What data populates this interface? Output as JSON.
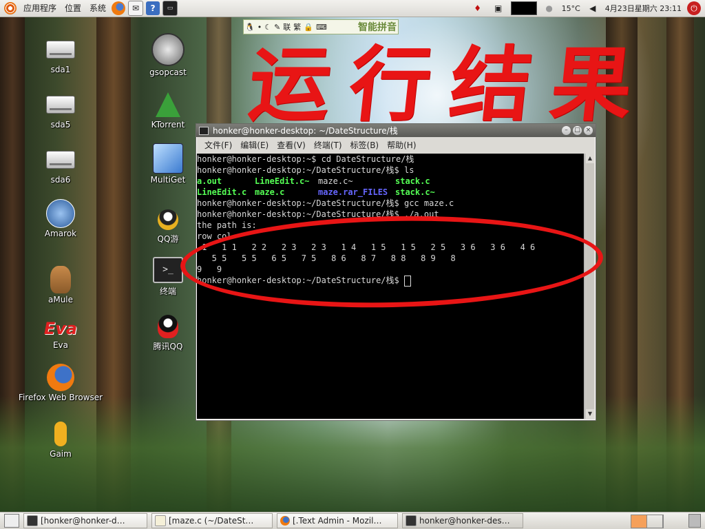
{
  "top_panel": {
    "menus": [
      "应用程序",
      "位置",
      "系统"
    ],
    "temperature": "15°C",
    "datetime": "4月23日星期六 23:11"
  },
  "ime": {
    "symbols": [
      "联",
      "繁"
    ],
    "name": "智能拼音"
  },
  "annotation": {
    "text": "运行结果"
  },
  "desktop_icons": [
    {
      "label": "sda1",
      "icon": "drive-icon"
    },
    {
      "label": "sda5",
      "icon": "drive-icon"
    },
    {
      "label": "sda6",
      "icon": "drive-icon"
    },
    {
      "label": "Amarok",
      "icon": "amarok-icon"
    },
    {
      "label": "aMule",
      "icon": "amule-icon"
    },
    {
      "label": "Eva",
      "icon": "eva-icon"
    },
    {
      "label": "Firefox Web Browser",
      "icon": "firefox-icon"
    },
    {
      "label": "Gaim",
      "icon": "gaim-icon"
    },
    {
      "label": "gsopcast",
      "icon": "gsopcast-icon"
    },
    {
      "label": "KTorrent",
      "icon": "ktorrent-icon"
    },
    {
      "label": "MultiGet",
      "icon": "multiget-icon"
    },
    {
      "label": "QQ游",
      "icon": "qq-game-icon"
    },
    {
      "label": "终端",
      "icon": "terminal-icon"
    },
    {
      "label": "腾讯QQ",
      "icon": "qq-icon"
    }
  ],
  "terminal": {
    "title": "honker@honker-desktop: ~/DateStructure/栈",
    "menu": [
      "文件(F)",
      "编辑(E)",
      "查看(V)",
      "终端(T)",
      "标签(B)",
      "帮助(H)"
    ],
    "lines": [
      "honker@honker-desktop:~$ cd DateStructure/栈",
      "honker@honker-desktop:~/DateStructure/栈$ ls",
      "",
      "",
      "honker@honker-desktop:~/DateStructure/栈$ gcc maze.c",
      "honker@honker-desktop:~/DateStructure/栈$ ./a.out",
      "the path is:",
      "row col",
      " 1   1 1   2 2   2 3   2 3   1 4   1 5   1 5   2 5   3 6   3 6   4 6",
      "   5 5   5 5   6 5   7 5   8 6   8 7   8 8   8 9   8",
      "9   9",
      "honker@honker-desktop:~/DateStructure/栈$ "
    ],
    "ls_files": [
      {
        "name": "a.out",
        "kind": "exec"
      },
      {
        "name": "LineEdit.c~",
        "kind": "exec"
      },
      {
        "name": "maze.c~",
        "kind": "plain"
      },
      {
        "name": "stack.c",
        "kind": "exec"
      },
      {
        "name": "LineEdit.c",
        "kind": "exec"
      },
      {
        "name": "maze.c",
        "kind": "exec"
      },
      {
        "name": "maze.rar_FILES",
        "kind": "dir"
      },
      {
        "name": "stack.c~",
        "kind": "exec"
      }
    ]
  },
  "taskbar": {
    "tasks": [
      {
        "label": "[honker@honker-d…",
        "icon": "terminal-icon"
      },
      {
        "label": "[maze.c (~/DateSt…",
        "icon": "text-editor-icon"
      },
      {
        "label": "[.Text Admin - Mozil…",
        "icon": "firefox-icon"
      },
      {
        "label": "honker@honker-des…",
        "icon": "terminal-icon"
      }
    ]
  },
  "colors": {
    "annotation_red": "#e81515",
    "ls_exec_green": "#55ff55",
    "ls_dir_blue": "#6666ff"
  }
}
